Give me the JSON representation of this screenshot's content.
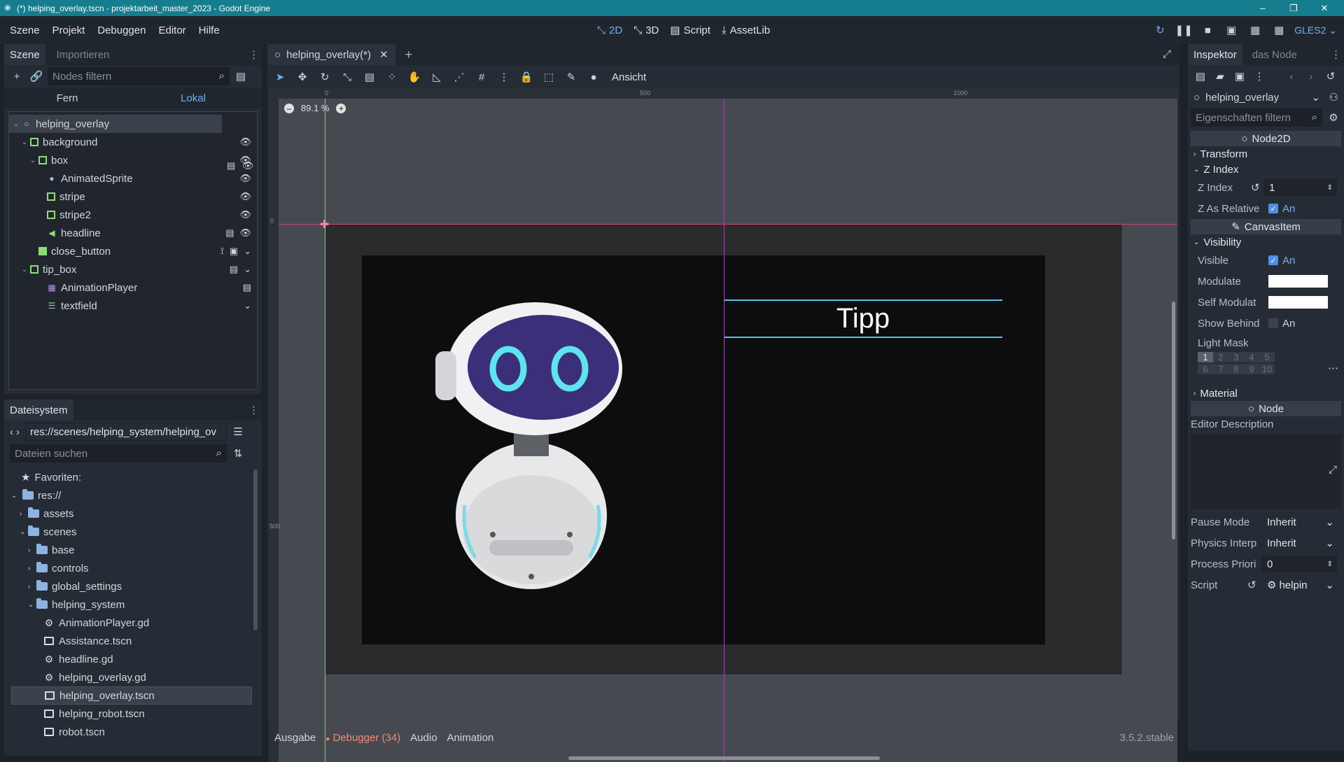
{
  "window": {
    "title": "(*) helping_overlay.tscn - projektarbeit_master_2023 - Godot Engine"
  },
  "menu": [
    "Szene",
    "Projekt",
    "Debuggen",
    "Editor",
    "Hilfe"
  ],
  "workspaces": [
    "2D",
    "3D",
    "Script",
    "AssetLib"
  ],
  "renderer": "GLES2",
  "scene_panel": {
    "tabs": [
      "Szene",
      "Importieren"
    ],
    "filter_placeholder": "Nodes filtern",
    "remote": "Fern",
    "local": "Lokal",
    "nodes": [
      {
        "label": "helping_overlay"
      },
      {
        "label": "background"
      },
      {
        "label": "box"
      },
      {
        "label": "AnimatedSprite"
      },
      {
        "label": "stripe"
      },
      {
        "label": "stripe2"
      },
      {
        "label": "headline"
      },
      {
        "label": "close_button"
      },
      {
        "label": "tip_box"
      },
      {
        "label": "AnimationPlayer"
      },
      {
        "label": "textfield"
      }
    ]
  },
  "filesystem": {
    "title": "Dateisystem",
    "path": "res://scenes/helping_system/helping_ov",
    "search_placeholder": "Dateien suchen",
    "items": [
      {
        "label": "Favoriten:"
      },
      {
        "label": "res://"
      },
      {
        "label": "assets"
      },
      {
        "label": "scenes"
      },
      {
        "label": "base"
      },
      {
        "label": "controls"
      },
      {
        "label": "global_settings"
      },
      {
        "label": "helping_system"
      },
      {
        "label": "AnimationPlayer.gd"
      },
      {
        "label": "Assistance.tscn"
      },
      {
        "label": "headline.gd"
      },
      {
        "label": "helping_overlay.gd"
      },
      {
        "label": "helping_overlay.tscn"
      },
      {
        "label": "helping_robot.tscn"
      },
      {
        "label": "robot.tscn"
      }
    ]
  },
  "editor": {
    "tab_label": "helping_overlay(*)",
    "view_menu": "Ansicht",
    "zoom": "89.1 %",
    "ruler_marks": [
      "0",
      "500",
      "1000"
    ],
    "ruler_v_marks": [
      "0",
      "500"
    ],
    "canvas_headline": "Tipp"
  },
  "bottom_bar": {
    "tabs": [
      "Ausgabe",
      "Debugger (34)",
      "Audio",
      "Animation"
    ],
    "version": "3.5.2.stable"
  },
  "inspector": {
    "tabs": [
      "Inspektor",
      "das Node"
    ],
    "node_name": "helping_overlay",
    "filter_placeholder": "Eigenschaften filtern",
    "class_node2d": "Node2D",
    "transform": "Transform",
    "z_index_section": "Z Index",
    "z_index_label": "Z Index",
    "z_index_value": "1",
    "z_as_relative_label": "Z As Relative",
    "on": "An",
    "class_canvasitem": "CanvasItem",
    "visibility": "Visibility",
    "visible_label": "Visible",
    "modulate_label": "Modulate",
    "self_modulate_label": "Self Modulat",
    "show_behind_label": "Show Behind",
    "light_mask_label": "Light Mask",
    "light_mask_bits": [
      "1",
      "2",
      "3",
      "4",
      "5",
      "6",
      "7",
      "8",
      "9",
      "10"
    ],
    "material": "Material",
    "class_node": "Node",
    "editor_description": "Editor Description",
    "pause_mode_label": "Pause Mode",
    "pause_mode_value": "Inherit",
    "physics_label": "Physics Interp",
    "physics_value": "Inherit",
    "process_label": "Process Priori",
    "process_value": "0",
    "script_label": "Script",
    "script_value": "helpin"
  },
  "colors": {
    "accent": "#4f90e3",
    "titlebar": "#157d8e",
    "canvas_bg": "#101113"
  }
}
